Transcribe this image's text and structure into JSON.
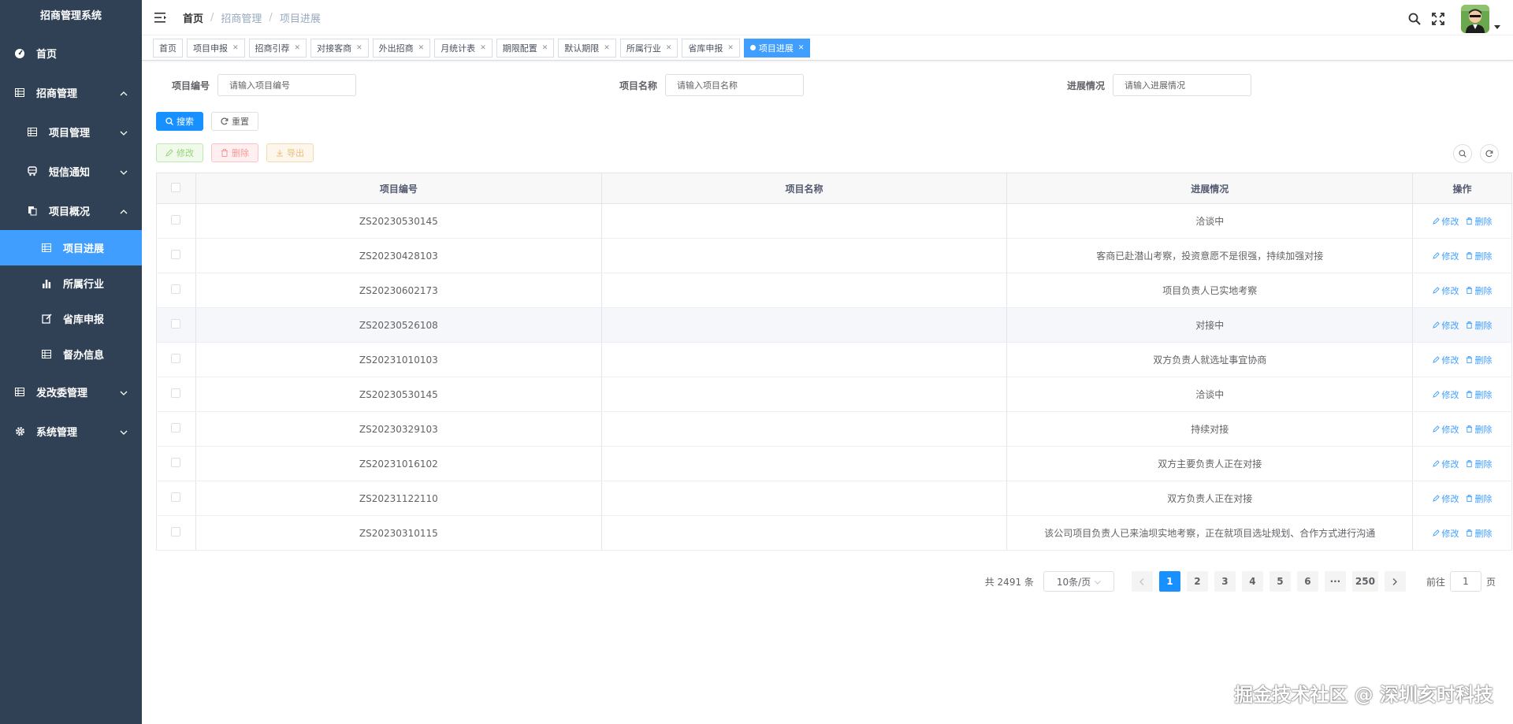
{
  "app": {
    "title": "招商管理系统"
  },
  "sidebar": {
    "items": [
      {
        "label": "首页",
        "icon": "dashboard-icon",
        "level": 1
      },
      {
        "label": "招商管理",
        "icon": "table-icon",
        "level": 1,
        "expanded": true
      },
      {
        "label": "项目管理",
        "icon": "table-icon",
        "level": 2,
        "expanded": false
      },
      {
        "label": "短信通知",
        "icon": "bus-icon",
        "level": 2,
        "expanded": false
      },
      {
        "label": "项目概况",
        "icon": "documents-icon",
        "level": 2,
        "expanded": true
      },
      {
        "label": "项目进展",
        "icon": "table-icon",
        "level": 3,
        "active": true
      },
      {
        "label": "所属行业",
        "icon": "bar-chart-icon",
        "level": 3
      },
      {
        "label": "省库申报",
        "icon": "edit-icon",
        "level": 3
      },
      {
        "label": "督办信息",
        "icon": "table-icon",
        "level": 3
      },
      {
        "label": "发改委管理",
        "icon": "table-icon",
        "level": 1,
        "expanded": false
      },
      {
        "label": "系统管理",
        "icon": "gear-icon",
        "level": 1,
        "expanded": false
      }
    ]
  },
  "breadcrumb": [
    "首页",
    "招商管理",
    "项目进展"
  ],
  "tags": [
    {
      "label": "首页",
      "closable": false
    },
    {
      "label": "项目申报",
      "closable": true
    },
    {
      "label": "招商引荐",
      "closable": true
    },
    {
      "label": "对接客商",
      "closable": true
    },
    {
      "label": "外出招商",
      "closable": true
    },
    {
      "label": "月统计表",
      "closable": true
    },
    {
      "label": "期限配置",
      "closable": true
    },
    {
      "label": "默认期限",
      "closable": true
    },
    {
      "label": "所属行业",
      "closable": true
    },
    {
      "label": "省库申报",
      "closable": true
    },
    {
      "label": "项目进展",
      "closable": true,
      "active": true
    }
  ],
  "search": {
    "fields": [
      {
        "label": "项目编号",
        "placeholder": "请输入项目编号"
      },
      {
        "label": "项目名称",
        "placeholder": "请输入项目名称"
      },
      {
        "label": "进展情况",
        "placeholder": "请输入进展情况"
      }
    ],
    "search_label": "搜索",
    "reset_label": "重置"
  },
  "toolbar": {
    "edit_label": "修改",
    "delete_label": "删除",
    "export_label": "导出"
  },
  "table": {
    "columns": [
      "项目编号",
      "项目名称",
      "进展情况",
      "操作"
    ],
    "row_edit": "修改",
    "row_delete": "删除",
    "rows": [
      {
        "code": "ZS20230530145",
        "name": "",
        "progress": "洽谈中"
      },
      {
        "code": "ZS20230428103",
        "name": "",
        "progress": "客商已赴潜山考察，投资意愿不是很强，持续加强对接"
      },
      {
        "code": "ZS20230602173",
        "name": "",
        "progress": "项目负责人已实地考察"
      },
      {
        "code": "ZS20230526108",
        "name": "",
        "progress": "对接中"
      },
      {
        "code": "ZS20231010103",
        "name": "",
        "progress": "双方负责人就选址事宜协商"
      },
      {
        "code": "ZS20230530145",
        "name": "",
        "progress": "洽谈中"
      },
      {
        "code": "ZS20230329103",
        "name": "",
        "progress": "持续对接"
      },
      {
        "code": "ZS20231016102",
        "name": "",
        "progress": "双方主要负责人正在对接"
      },
      {
        "code": "ZS20231122110",
        "name": "",
        "progress": "双方负责人正在对接"
      },
      {
        "code": "ZS20230310115",
        "name": "",
        "progress": "该公司项目负责人已来油坝实地考察，正在就项目选址规划、合作方式进行沟通"
      }
    ]
  },
  "pagination": {
    "total_text": "共 2491 条",
    "page_size": "10条/页",
    "pages": [
      "1",
      "2",
      "3",
      "4",
      "5",
      "6",
      "···",
      "250"
    ],
    "current": "1",
    "goto_label": "前往",
    "goto_value": "1",
    "page_unit": "页"
  },
  "watermark": "掘金技术社区 @ 深圳亥时科技",
  "colors": {
    "sidebar": "#304156",
    "primary": "#409eff",
    "active_menu": "#409eff"
  }
}
